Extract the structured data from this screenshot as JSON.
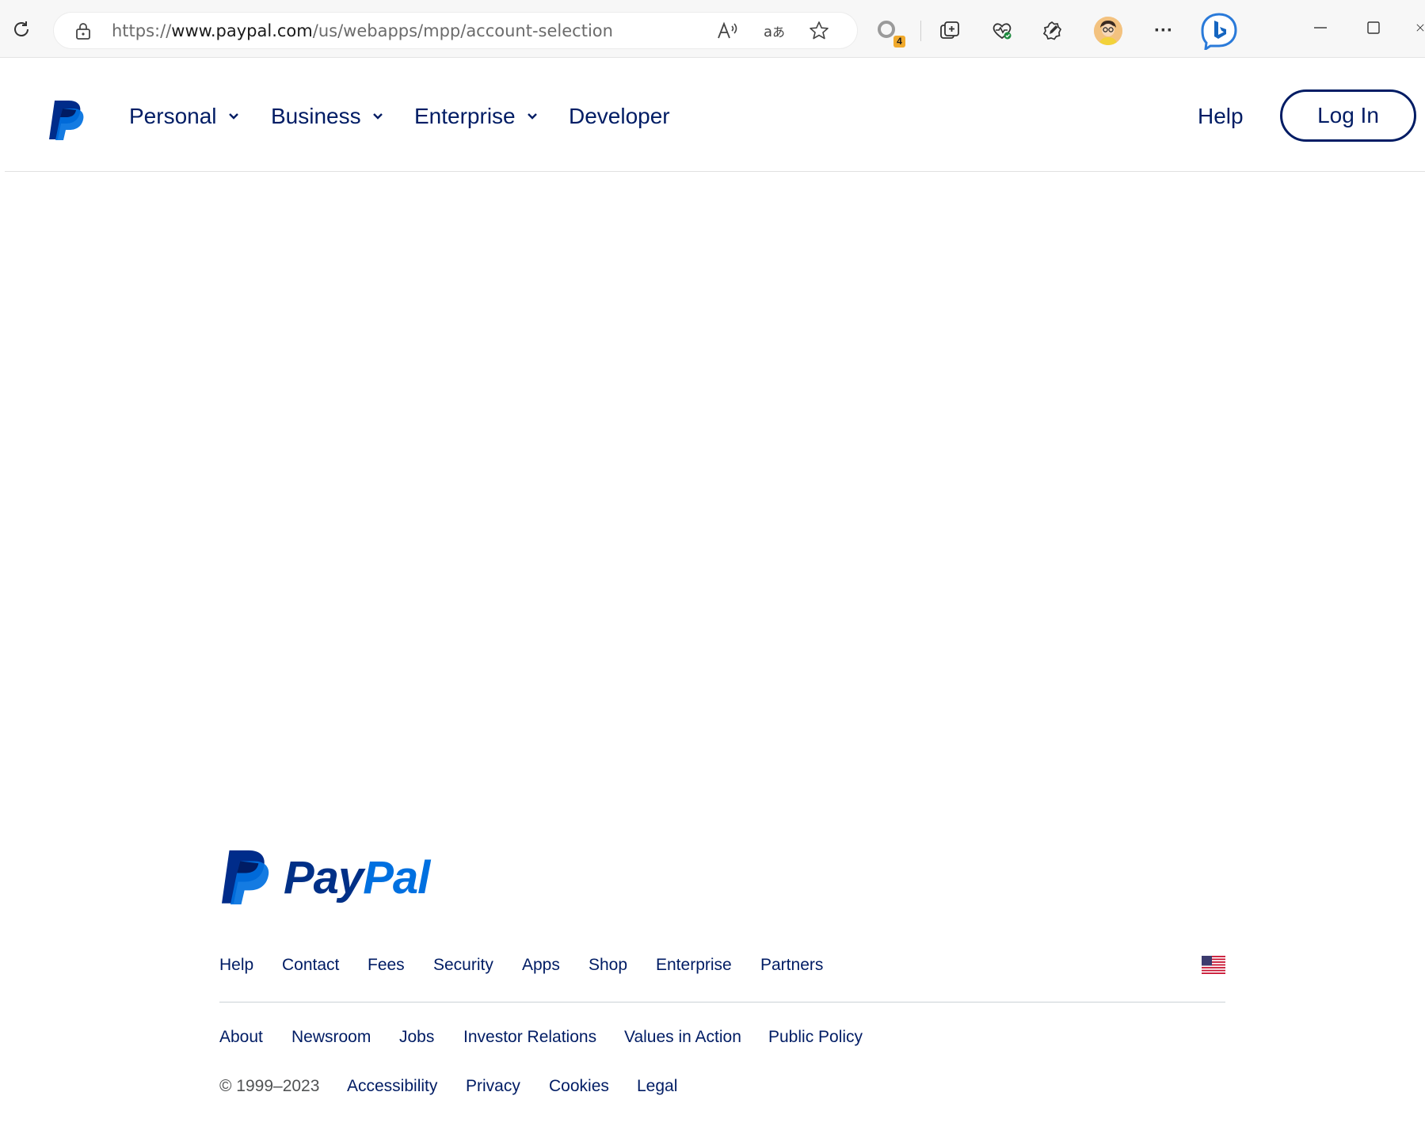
{
  "browser": {
    "url_prefix": "https://",
    "url_domain": "www.paypal.com",
    "url_path": "/us/webapps/mpp/account-selection",
    "extension_badge": "4",
    "menu_glyph": "···"
  },
  "header": {
    "nav": [
      {
        "label": "Personal",
        "has_menu": true
      },
      {
        "label": "Business",
        "has_menu": true
      },
      {
        "label": "Enterprise",
        "has_menu": true
      },
      {
        "label": "Developer",
        "has_menu": false
      }
    ],
    "help_label": "Help",
    "login_label": "Log In"
  },
  "footer": {
    "wordmark_pay": "Pay",
    "wordmark_pal": "Pal",
    "row1": [
      "Help",
      "Contact",
      "Fees",
      "Security",
      "Apps",
      "Shop",
      "Enterprise",
      "Partners"
    ],
    "row2": [
      "About",
      "Newsroom",
      "Jobs",
      "Investor Relations",
      "Values in Action",
      "Public Policy"
    ],
    "copyright": "© 1999–2023",
    "row3": [
      "Accessibility",
      "Privacy",
      "Cookies",
      "Legal"
    ],
    "country_flag": "us-flag-icon"
  },
  "colors": {
    "navy": "#001c64",
    "paypal_blue": "#003087",
    "paypal_light_blue": "#0070e0",
    "copyright_gray": "#515354"
  }
}
